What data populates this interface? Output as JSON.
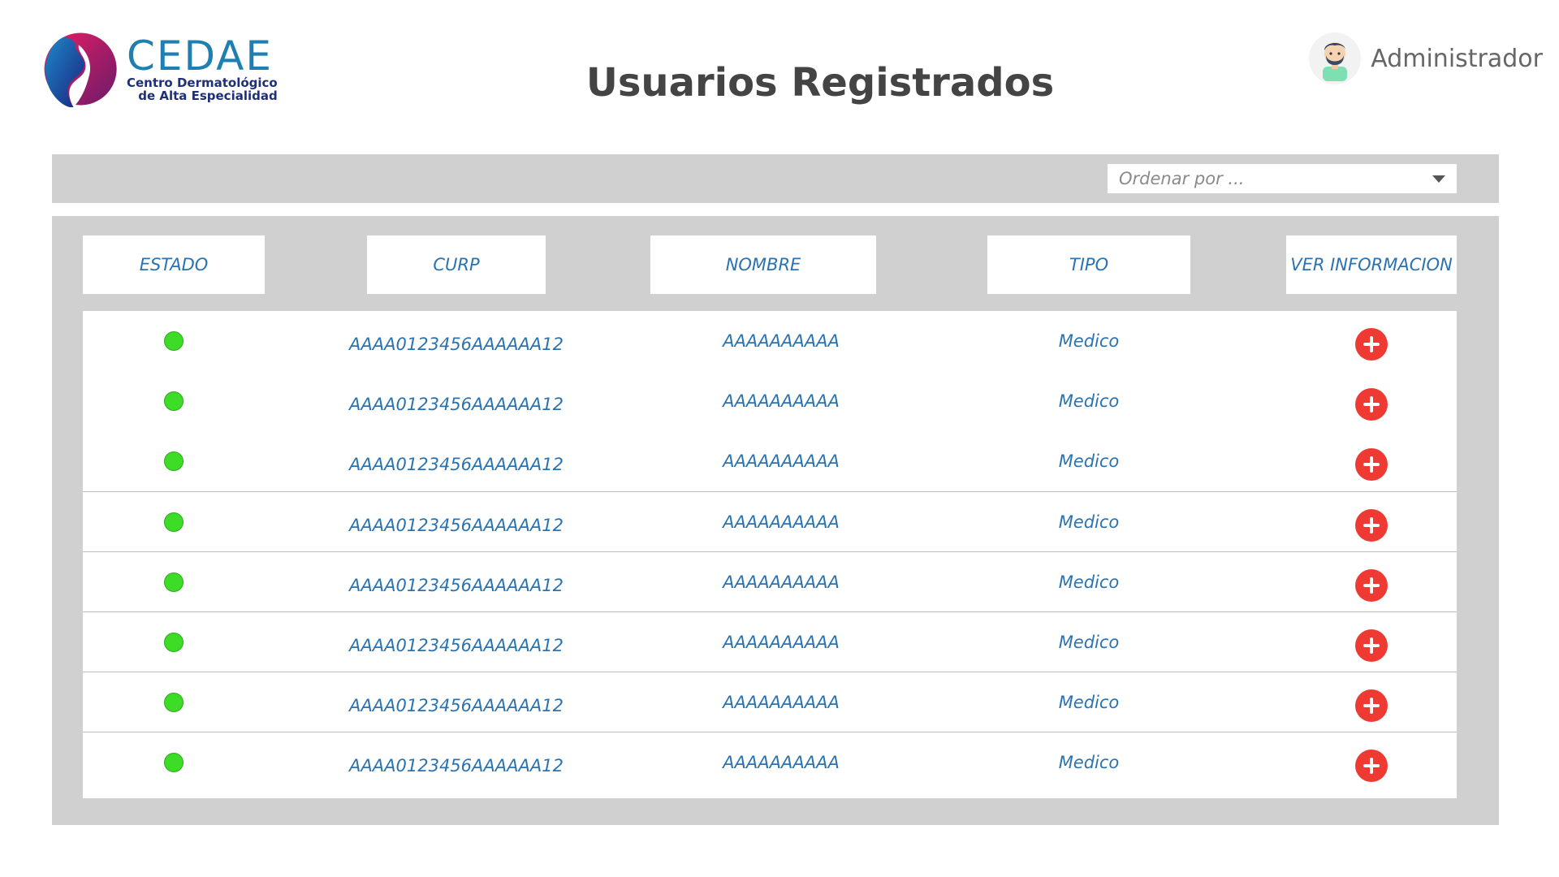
{
  "header": {
    "logo_name": "CEDAE",
    "logo_sub_line1": "Centro Dermatológico",
    "logo_sub_line2": "de Alta Especialidad",
    "title": "Usuarios Registrados",
    "user_name": "Administrador"
  },
  "toolbar": {
    "sort_placeholder": "Ordenar por ..."
  },
  "table": {
    "columns": [
      "ESTADO",
      "CURP",
      "NOMBRE",
      "TIPO",
      "VER INFORMACION"
    ],
    "rows": [
      {
        "status": "active",
        "curp": "AAAA0123456AAAAAA12",
        "nombre": "AAAAAAAAAA",
        "tipo": "Medico"
      },
      {
        "status": "active",
        "curp": "AAAA0123456AAAAAA12",
        "nombre": "AAAAAAAAAA",
        "tipo": "Medico"
      },
      {
        "status": "active",
        "curp": "AAAA0123456AAAAAA12",
        "nombre": "AAAAAAAAAA",
        "tipo": "Medico"
      },
      {
        "status": "active",
        "curp": "AAAA0123456AAAAAA12",
        "nombre": "AAAAAAAAAA",
        "tipo": "Medico"
      },
      {
        "status": "active",
        "curp": "AAAA0123456AAAAAA12",
        "nombre": "AAAAAAAAAA",
        "tipo": "Medico"
      },
      {
        "status": "active",
        "curp": "AAAA0123456AAAAAA12",
        "nombre": "AAAAAAAAAA",
        "tipo": "Medico"
      },
      {
        "status": "active",
        "curp": "AAAA0123456AAAAAA12",
        "nombre": "AAAAAAAAAA",
        "tipo": "Medico"
      },
      {
        "status": "active",
        "curp": "AAAA0123456AAAAAA12",
        "nombre": "AAAAAAAAAA",
        "tipo": "Medico"
      }
    ]
  },
  "colors": {
    "accent_text": "#2b73b0",
    "status_active": "#3ddc27",
    "action_button": "#ee3a33",
    "panel_bg": "#d0d0d0"
  },
  "icons": {
    "status": "status-dot-icon",
    "action": "plus-circle-icon",
    "avatar": "user-avatar-icon",
    "dropdown": "chevron-down-icon"
  }
}
